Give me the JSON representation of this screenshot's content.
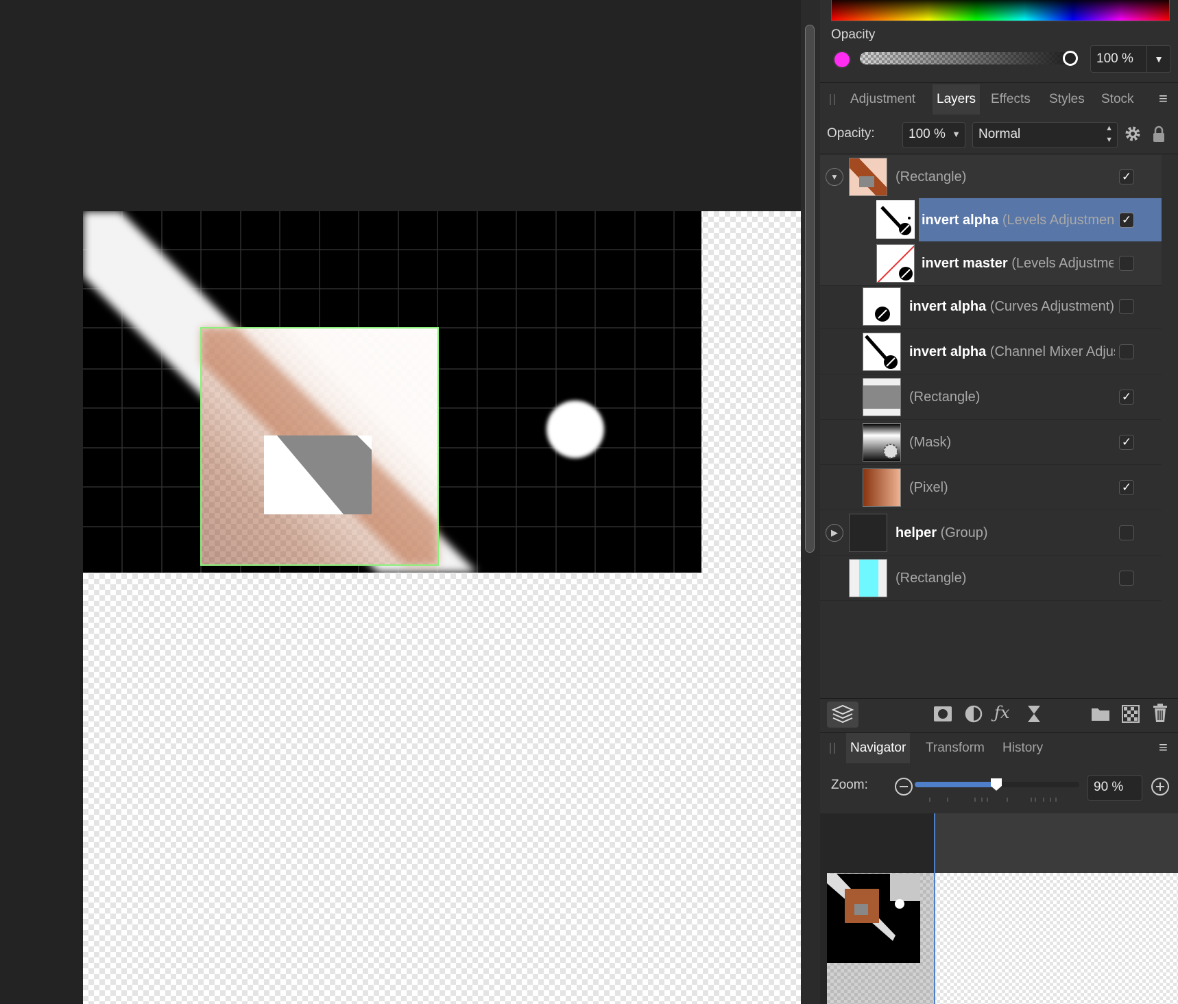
{
  "color_panel": {
    "opacity_label": "Opacity",
    "swatch_color": "#ff2cf2",
    "opacity_value": "100 %",
    "opacity_fraction": 1.0
  },
  "layers_tabs": {
    "tabs": [
      "Adjustment",
      "Layers",
      "Effects",
      "Styles",
      "Stock"
    ],
    "active": "Layers"
  },
  "layer_controls": {
    "opacity_label": "Opacity:",
    "opacity_value": "100 %",
    "blend_mode": "Normal"
  },
  "layers": [
    {
      "name": "",
      "type": "(Rectangle)",
      "checked": true,
      "expanded": true
    },
    {
      "name": "invert alpha",
      "type": "(Levels Adjustment)",
      "checked": true,
      "selected": true
    },
    {
      "name": "invert master",
      "type": "(Levels Adjustment)",
      "checked": false
    },
    {
      "name": "invert alpha",
      "type": "(Curves Adjustment)",
      "checked": false
    },
    {
      "name": "invert alpha",
      "type": "(Channel Mixer Adjustment)",
      "checked": false
    },
    {
      "name": "",
      "type": "(Rectangle)",
      "checked": true
    },
    {
      "name": "",
      "type": "(Mask)",
      "checked": true
    },
    {
      "name": "",
      "type": "(Pixel)",
      "checked": true
    },
    {
      "name": "helper",
      "type": "(Group)",
      "checked": false,
      "collapsed": true
    },
    {
      "name": "",
      "type": "(Rectangle)",
      "checked": false
    }
  ],
  "bottom_tabs": {
    "tabs": [
      "Navigator",
      "Transform",
      "History"
    ],
    "active": "Navigator"
  },
  "navigator": {
    "zoom_label": "Zoom:",
    "zoom_value": "90 %",
    "zoom_fraction": 0.5
  },
  "icons": {
    "layers_icon": "layers-stack-icon",
    "mask": "mask-icon",
    "adjust": "adjustment-icon",
    "fx": "fx-icon",
    "hourglass": "live-filter-icon",
    "folder": "group-icon",
    "pixel": "pixel-layer-icon",
    "trash": "trash-icon"
  }
}
